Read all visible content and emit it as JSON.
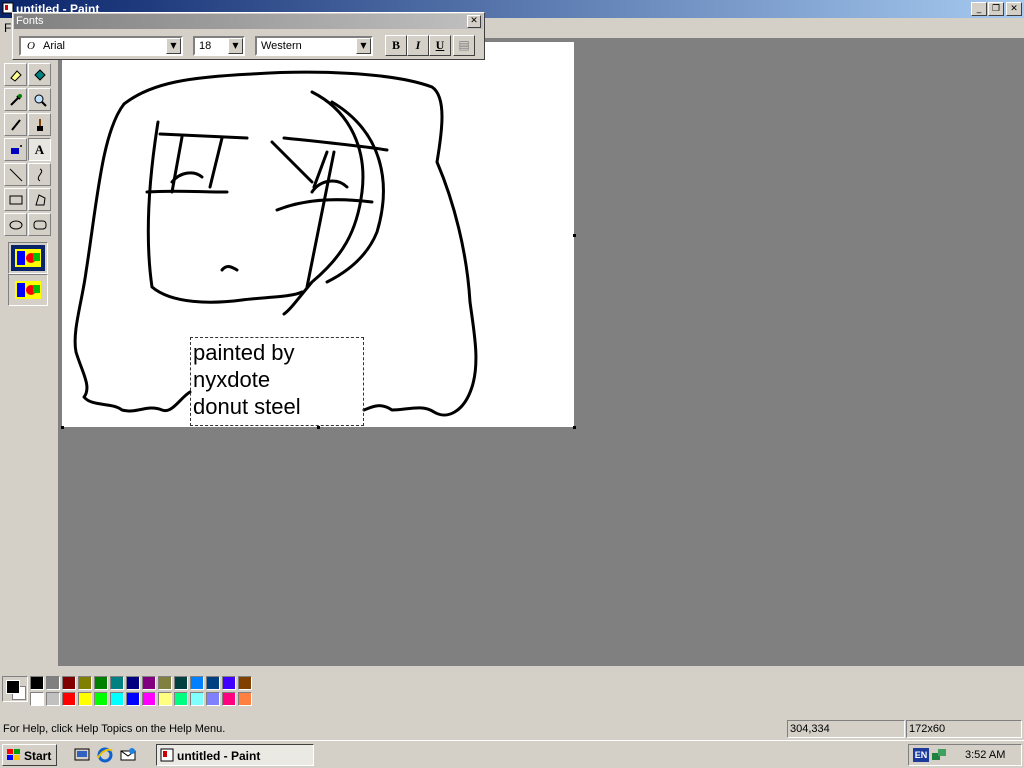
{
  "window": {
    "title": "untitled - Paint"
  },
  "menubar": {
    "visible_fragment": "F"
  },
  "fonts_toolbar": {
    "title": "Fonts",
    "font_name": "Arial",
    "font_size": "18",
    "script": "Western",
    "bold": "B",
    "italic": "I",
    "underline": "U"
  },
  "canvas": {
    "text_lines": [
      "painted by",
      "nyxdote",
      "donut steel"
    ]
  },
  "palette": {
    "foreground": "#000000",
    "background": "#ffffff",
    "row1": [
      "#000000",
      "#808080",
      "#800000",
      "#808000",
      "#008000",
      "#008080",
      "#000080",
      "#800080",
      "#808040",
      "#004040",
      "#0080ff",
      "#004080",
      "#4000ff",
      "#804000"
    ],
    "row2": [
      "#ffffff",
      "#c0c0c0",
      "#ff0000",
      "#ffff00",
      "#00ff00",
      "#00ffff",
      "#0000ff",
      "#ff00ff",
      "#ffff80",
      "#00ff80",
      "#80ffff",
      "#8080ff",
      "#ff0080",
      "#ff8040"
    ]
  },
  "statusbar": {
    "help": "For Help, click Help Topics on the Help Menu.",
    "coords": "304,334",
    "size": "172x60"
  },
  "taskbar": {
    "start": "Start",
    "task": "untitled - Paint",
    "lang": "EN",
    "clock": "3:52 AM"
  },
  "tools": [
    "free-select",
    "select",
    "eraser",
    "fill",
    "color-picker",
    "magnifier",
    "pencil",
    "brush",
    "airbrush",
    "text",
    "line",
    "curve",
    "rectangle",
    "polygon",
    "ellipse",
    "rounded-rectangle"
  ]
}
